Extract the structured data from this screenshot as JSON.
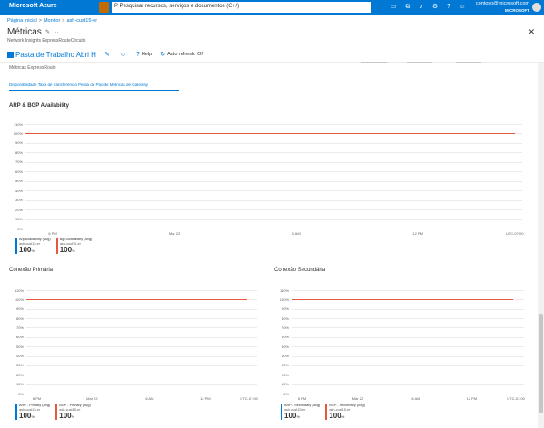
{
  "topbar": {
    "brand": "Microsoft Azure",
    "search_text": "P Pesquisar recursos, serviços e documentos (G+/)",
    "account_email": "contoso@microsoft.com",
    "account_tenant": "MICROSOFT",
    "icons": [
      "portal-icon",
      "cloud-shell-icon",
      "directory-icon",
      "notifications-icon",
      "settings-icon",
      "help-icon",
      "feedback-icon"
    ]
  },
  "breadcrumb": [
    "Página Inicial",
    "Monitor",
    "ash-cust15-er"
  ],
  "header": {
    "title": "Métricas",
    "subtitle": "Network Insights ExpressRouteCircuits"
  },
  "commandbar": {
    "workbook_label": "Pasta de Trabalho Abri H",
    "help_label": "Help",
    "auto_refresh_label": "Auto refresh: Off"
  },
  "section_label": "Métricas ExpressRoute",
  "tabs_text": "Disponibilidade   Taxa de transferência   Perda de Pacote   Métricas de Gateway",
  "charts": {
    "main": {
      "title": "ARP & BGP Availability",
      "y_ticks": [
        "110%",
        "100%",
        "90%",
        "80%",
        "70%",
        "60%",
        "50%",
        "40%",
        "30%",
        "20%",
        "10%",
        "0%"
      ],
      "x_ticks": [
        "6 PM",
        "Mar 22",
        "6 AM",
        "12 PM",
        "UTC-07:00"
      ],
      "legend": [
        {
          "label": "Arp Availability (Avg)",
          "sub": "ash-cust15-er",
          "value": "100",
          "unit": "%",
          "color": "#0078d4"
        },
        {
          "label": "Bgp Availability (Avg)",
          "sub": "ash-cust15-er",
          "value": "100",
          "unit": "%",
          "color": "#e8583d"
        }
      ]
    },
    "primary": {
      "title": "Conexão Primária",
      "y_ticks": [
        "110%",
        "100%",
        "90%",
        "80%",
        "70%",
        "60%",
        "50%",
        "40%",
        "30%",
        "20%",
        "10%",
        "0%"
      ],
      "x_ticks": [
        "6 PM",
        "Mar 22",
        "6 AM",
        "12 PM",
        "UTC-07:00"
      ],
      "legend": [
        {
          "label": "ARP - Primary (Avg)",
          "sub": "ash-cust15-er",
          "value": "100",
          "unit": "%",
          "color": "#0078d4"
        },
        {
          "label": "BGP - Primary (Avg)",
          "sub": "ash-cust15-er",
          "value": "100",
          "unit": "%",
          "color": "#e8583d"
        }
      ]
    },
    "secondary": {
      "title": "Conexão Secundária",
      "y_ticks": [
        "110%",
        "100%",
        "90%",
        "80%",
        "70%",
        "60%",
        "50%",
        "40%",
        "30%",
        "20%",
        "10%",
        "0%"
      ],
      "x_ticks": [
        "6 PM",
        "Mar 22",
        "6 AM",
        "12 PM",
        "UTC-07:00"
      ],
      "legend": [
        {
          "label": "ARP - Secondary (Avg)",
          "sub": "ash-cust15-er",
          "value": "100",
          "unit": "%",
          "color": "#0078d4"
        },
        {
          "label": "BGP - Secondary (Avg)",
          "sub": "ash-cust15-er",
          "value": "100",
          "unit": "%",
          "color": "#e8583d"
        }
      ]
    }
  },
  "chart_data": [
    {
      "type": "line",
      "title": "ARP & BGP Availability",
      "x": [
        "6 PM",
        "Mar 22",
        "6 AM",
        "12 PM"
      ],
      "ylim": [
        0,
        110
      ],
      "ylabel": "",
      "series": [
        {
          "name": "Bgp Availability (Avg)",
          "values": [
            100,
            100,
            100,
            100
          ]
        }
      ]
    },
    {
      "type": "line",
      "title": "Conexão Primária",
      "x": [
        "6 PM",
        "Mar 22",
        "6 AM",
        "12 PM"
      ],
      "ylim": [
        0,
        110
      ],
      "series": [
        {
          "name": "BGP - Primary (Avg)",
          "values": [
            100,
            100,
            100,
            100
          ]
        }
      ]
    },
    {
      "type": "line",
      "title": "Conexão Secundária",
      "x": [
        "6 PM",
        "Mar 22",
        "6 AM",
        "12 PM"
      ],
      "ylim": [
        0,
        110
      ],
      "series": [
        {
          "name": "BGP - Secondary (Avg)",
          "values": [
            100,
            100,
            100,
            100
          ]
        }
      ]
    }
  ]
}
